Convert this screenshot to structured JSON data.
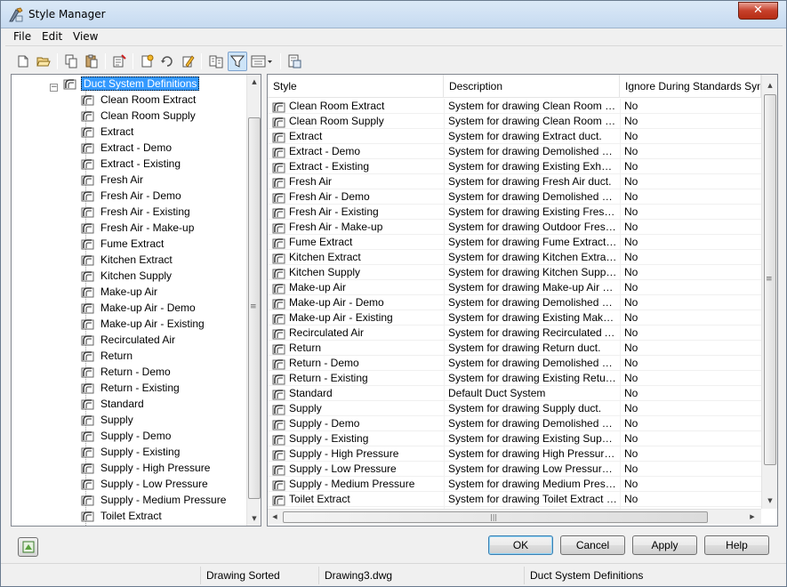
{
  "window": {
    "title": "Style Manager",
    "close_label": "✕"
  },
  "menu": [
    {
      "label": "File"
    },
    {
      "label": "Edit"
    },
    {
      "label": "View"
    }
  ],
  "toolbar": {
    "buttons": [
      {
        "name": "new-drawing-icon"
      },
      {
        "name": "open-drawing-icon"
      },
      {
        "name": "copy-icon"
      },
      {
        "name": "paste-icon"
      },
      {
        "name": "purge-styles-icon"
      },
      {
        "name": "new-style-icon"
      },
      {
        "name": "set-from-icon"
      },
      {
        "name": "edit-style-icon"
      },
      {
        "name": "inline-edit-icon"
      },
      {
        "name": "filter-style-type-icon"
      },
      {
        "name": "view-mode-icon"
      },
      {
        "name": "toggle-view-icon"
      }
    ]
  },
  "tree": {
    "parent": "Duct System Definitions",
    "expander": "−",
    "items": [
      "Clean Room Extract",
      "Clean Room Supply",
      "Extract",
      "Extract - Demo",
      "Extract - Existing",
      "Fresh Air",
      "Fresh Air - Demo",
      "Fresh Air - Existing",
      "Fresh Air - Make-up",
      "Fume Extract",
      "Kitchen Extract",
      "Kitchen Supply",
      "Make-up Air",
      "Make-up Air - Demo",
      "Make-up Air - Existing",
      "Recirculated Air",
      "Return",
      "Return - Demo",
      "Return - Existing",
      "Standard",
      "Supply",
      "Supply - Demo",
      "Supply - Existing",
      "Supply - High Pressure",
      "Supply - Low Pressure",
      "Supply - Medium Pressure",
      "Toilet Extract"
    ]
  },
  "list": {
    "columns": [
      "Style",
      "Description",
      "Ignore During Standards Synch"
    ],
    "rows": [
      {
        "style": "Clean Room Extract",
        "description": "System for drawing Clean Room Ext...",
        "ignore": "No"
      },
      {
        "style": "Clean Room Supply",
        "description": "System for drawing Clean Room Sup...",
        "ignore": "No"
      },
      {
        "style": "Extract",
        "description": "System for drawing Extract duct.",
        "ignore": "No"
      },
      {
        "style": "Extract - Demo",
        "description": "System for drawing Demolished Extr...",
        "ignore": "No"
      },
      {
        "style": "Extract - Existing",
        "description": "System for drawing Existing Exhaus...",
        "ignore": "No"
      },
      {
        "style": "Fresh Air",
        "description": "System for drawing Fresh Air duct.",
        "ignore": "No"
      },
      {
        "style": "Fresh Air - Demo",
        "description": "System for drawing Demolished Fres...",
        "ignore": "No"
      },
      {
        "style": "Fresh Air - Existing",
        "description": "System for drawing Existing Fresh A...",
        "ignore": "No"
      },
      {
        "style": "Fresh Air - Make-up",
        "description": "System for drawing Outdoor Fresh ...",
        "ignore": "No"
      },
      {
        "style": "Fume Extract",
        "description": "System for drawing Fume Extract d...",
        "ignore": "No"
      },
      {
        "style": "Kitchen Extract",
        "description": "System for drawing Kitchen Extract ...",
        "ignore": "No"
      },
      {
        "style": "Kitchen Supply",
        "description": "System for drawing Kitchen Supply ...",
        "ignore": "No"
      },
      {
        "style": "Make-up Air",
        "description": "System for drawing Make-up Air duct.",
        "ignore": "No"
      },
      {
        "style": "Make-up Air - Demo",
        "description": "System for drawing Demolished Mak...",
        "ignore": "No"
      },
      {
        "style": "Make-up Air - Existing",
        "description": "System for drawing Existing Make-u...",
        "ignore": "No"
      },
      {
        "style": "Recirculated Air",
        "description": "System for drawing Recirculated Air ...",
        "ignore": "No"
      },
      {
        "style": "Return",
        "description": "System for drawing Return duct.",
        "ignore": "No"
      },
      {
        "style": "Return - Demo",
        "description": "System for drawing Demolished Ret...",
        "ignore": "No"
      },
      {
        "style": "Return - Existing",
        "description": "System for drawing Existing Return ...",
        "ignore": "No"
      },
      {
        "style": "Standard",
        "description": "Default Duct System",
        "ignore": "No"
      },
      {
        "style": "Supply",
        "description": "System for drawing Supply duct.",
        "ignore": "No"
      },
      {
        "style": "Supply - Demo",
        "description": "System for drawing Demolished Sup...",
        "ignore": "No"
      },
      {
        "style": "Supply - Existing",
        "description": "System for drawing Existing Supply ...",
        "ignore": "No"
      },
      {
        "style": "Supply - High Pressure",
        "description": "System for drawing High Pressure S...",
        "ignore": "No"
      },
      {
        "style": "Supply - Low Pressure",
        "description": "System for drawing Low Pressure S...",
        "ignore": "No"
      },
      {
        "style": "Supply - Medium Pressure",
        "description": "System for drawing Medium Pressur...",
        "ignore": "No"
      },
      {
        "style": "Toilet Extract",
        "description": "System for drawing Toilet Extract d...",
        "ignore": "No"
      }
    ]
  },
  "buttons": {
    "ok": "OK",
    "cancel": "Cancel",
    "apply": "Apply",
    "help": "Help"
  },
  "status": {
    "state": "Drawing Sorted",
    "drawing": "Drawing3.dwg",
    "category": "Duct System Definitions"
  },
  "scroll": {
    "up": "▲",
    "down": "▼",
    "left": "◀",
    "right": "▶",
    "grip_v": "≡",
    "grip_h": "|||"
  }
}
